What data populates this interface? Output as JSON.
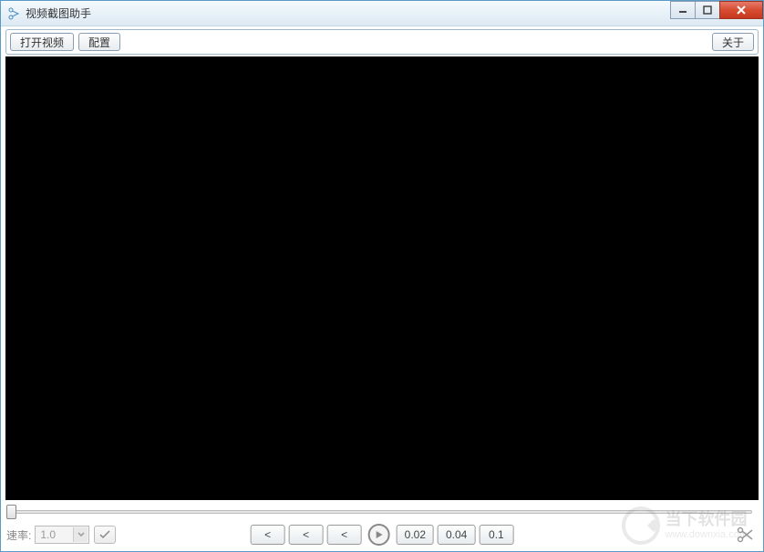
{
  "titlebar": {
    "title": "视频截图助手"
  },
  "toolbar": {
    "open_video": "打开视频",
    "config": "配置",
    "about": "关于"
  },
  "playback": {
    "speed_label": "速率:",
    "speed_value": "1.0",
    "step_back_buttons": [
      "<",
      "<",
      "<"
    ],
    "step_forward_buttons": [
      "0.02",
      "0.04",
      "0.1"
    ]
  },
  "watermark": {
    "cn": "当下软件园",
    "en": "www.downxia.com"
  }
}
